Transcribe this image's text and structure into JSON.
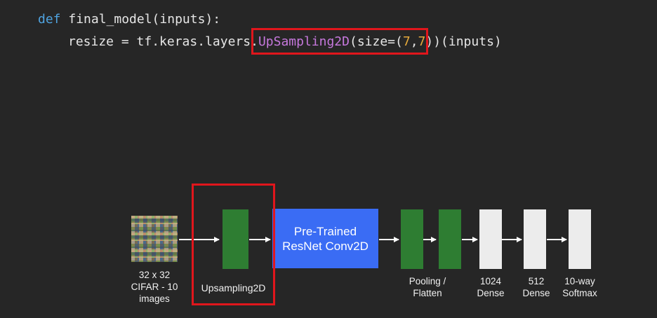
{
  "code": {
    "line1": {
      "keyword": "def",
      "text": " final_model(inputs):"
    },
    "line2": {
      "prefix": "resize = tf.keras.layers.",
      "function": "UpSampling2D",
      "args_open": "(size=(",
      "arg1": "7",
      "comma": ",",
      "arg2": "7",
      "args_close": "))(inputs)"
    }
  },
  "diagram": {
    "input_label": "32 x 32\nCIFAR - 10\nimages",
    "upsampling_label": "Upsampling2D",
    "resnet_label": "Pre-Trained\nResNet Conv2D",
    "pooling_label": "Pooling /\nFlatten",
    "dense1024_label": "1024\nDense",
    "dense512_label": "512\nDense",
    "softmax_label": "10-way\nSoftmax"
  },
  "colors": {
    "background": "#262626",
    "highlight": "#e0161c",
    "green": "#2e7d32",
    "blue": "#3a6cf4",
    "white_block": "#ececec",
    "arrow": "#ffffff"
  }
}
